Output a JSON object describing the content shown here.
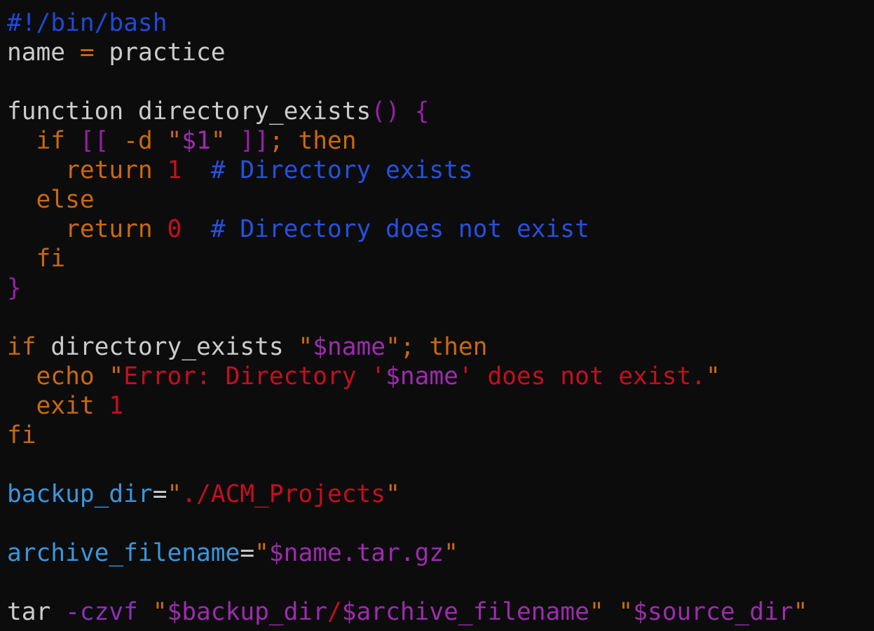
{
  "colors": {
    "background": "#0c0c0c",
    "default": "#cccccc",
    "shebang": "#1f49d8",
    "comment": "#2650e0",
    "keyword": "#c9690f",
    "bracket": "#9a1fa8",
    "variable": "#9e2bb0",
    "string": "#c50f1f",
    "number": "#c50f1f",
    "option": "#8e2fbf",
    "assign_name": "#3a96dd"
  },
  "lines": [
    [
      {
        "t": "#!/bin/bash",
        "c": "shebang"
      }
    ],
    [
      {
        "t": "name ",
        "c": "default"
      },
      {
        "t": "=",
        "c": "keyword"
      },
      {
        "t": " practice",
        "c": "default"
      }
    ],
    [],
    [
      {
        "t": "function directory_exists",
        "c": "default"
      },
      {
        "t": "()",
        "c": "bracket"
      },
      {
        "t": " ",
        "c": "default"
      },
      {
        "t": "{",
        "c": "bracket"
      }
    ],
    [
      {
        "t": "  if ",
        "c": "keyword"
      },
      {
        "t": "[[ ",
        "c": "bracket"
      },
      {
        "t": "-d ",
        "c": "keyword"
      },
      {
        "t": "\"",
        "c": "keyword"
      },
      {
        "t": "$1",
        "c": "variable"
      },
      {
        "t": "\" ",
        "c": "keyword"
      },
      {
        "t": "]]",
        "c": "bracket"
      },
      {
        "t": "; then",
        "c": "keyword"
      }
    ],
    [
      {
        "t": "    return ",
        "c": "keyword"
      },
      {
        "t": "1",
        "c": "number"
      },
      {
        "t": "  # Directory exists",
        "c": "comment"
      }
    ],
    [
      {
        "t": "  else",
        "c": "keyword"
      }
    ],
    [
      {
        "t": "    return ",
        "c": "keyword"
      },
      {
        "t": "0",
        "c": "number"
      },
      {
        "t": "  # Directory does not exist",
        "c": "comment"
      }
    ],
    [
      {
        "t": "  fi",
        "c": "keyword"
      }
    ],
    [
      {
        "t": "}",
        "c": "bracket"
      }
    ],
    [],
    [
      {
        "t": "if ",
        "c": "keyword"
      },
      {
        "t": "directory_exists ",
        "c": "default"
      },
      {
        "t": "\"",
        "c": "keyword"
      },
      {
        "t": "$name",
        "c": "variable"
      },
      {
        "t": "\"",
        "c": "keyword"
      },
      {
        "t": "; then",
        "c": "keyword"
      }
    ],
    [
      {
        "t": "  echo ",
        "c": "keyword"
      },
      {
        "t": "\"",
        "c": "keyword"
      },
      {
        "t": "Error: Directory '",
        "c": "string"
      },
      {
        "t": "$name",
        "c": "variable"
      },
      {
        "t": "' does not exist.",
        "c": "string"
      },
      {
        "t": "\"",
        "c": "keyword"
      }
    ],
    [
      {
        "t": "  exit ",
        "c": "keyword"
      },
      {
        "t": "1",
        "c": "number"
      }
    ],
    [
      {
        "t": "fi",
        "c": "keyword"
      }
    ],
    [],
    [
      {
        "t": "backup_dir",
        "c": "assign_name"
      },
      {
        "t": "=",
        "c": "default"
      },
      {
        "t": "\"",
        "c": "keyword"
      },
      {
        "t": "./ACM_Projects",
        "c": "string"
      },
      {
        "t": "\"",
        "c": "keyword"
      }
    ],
    [],
    [
      {
        "t": "archive_filename",
        "c": "assign_name"
      },
      {
        "t": "=",
        "c": "default"
      },
      {
        "t": "\"",
        "c": "keyword"
      },
      {
        "t": "$name.tar.gz",
        "c": "variable"
      },
      {
        "t": "\"",
        "c": "keyword"
      }
    ],
    [],
    [
      {
        "t": "tar ",
        "c": "default"
      },
      {
        "t": "-czvf ",
        "c": "option"
      },
      {
        "t": "\"",
        "c": "keyword"
      },
      {
        "t": "$backup_dir",
        "c": "variable"
      },
      {
        "t": "/",
        "c": "string"
      },
      {
        "t": "$archive_filename",
        "c": "variable"
      },
      {
        "t": "\" ",
        "c": "keyword"
      },
      {
        "t": "\"",
        "c": "keyword"
      },
      {
        "t": "$source_dir",
        "c": "variable"
      },
      {
        "t": "\"",
        "c": "keyword"
      }
    ]
  ]
}
